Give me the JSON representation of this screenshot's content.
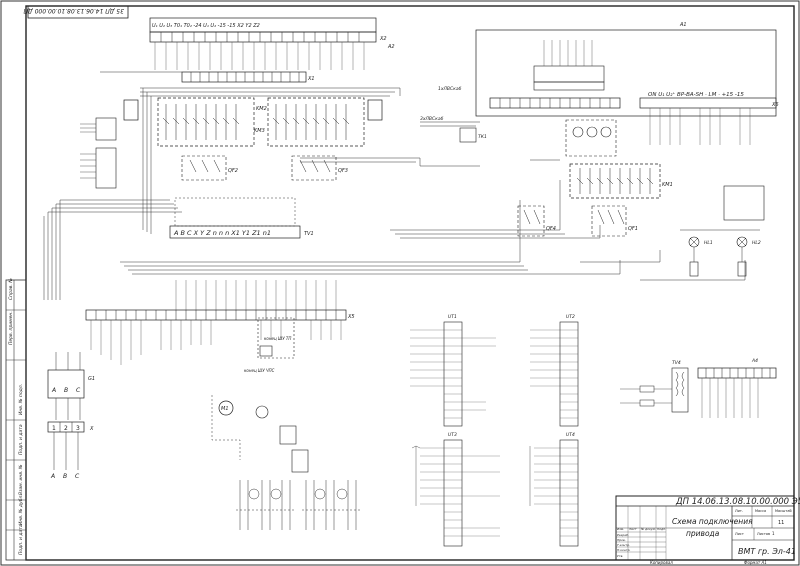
{
  "stamp": {
    "rotated_code": "35 ДП 14.06.13.08.10.00.000 ДП",
    "doc_code": "ДП 14.06.13.08.10.00.000 Э5",
    "title_line1": "Схема подключения",
    "title_line2": "привода",
    "org": "ВМТ гр. Эл-41",
    "sheet_label": "Лит.",
    "mass_label": "Масса",
    "scale_label": "Масштаб",
    "sheet_field": "Лист",
    "sheets_field": "Листов",
    "sheet_num": "11",
    "total_label": "1",
    "copied": "Копировал",
    "format": "Формат А1",
    "rows": [
      "Изм.",
      "Лист",
      "№ докум.",
      "Подп.",
      "Дата"
    ],
    "roles": [
      "Разраб.",
      "Пров.",
      "Т.контр.",
      "Н.контр.",
      "Утв."
    ]
  },
  "side_strip": [
    "Перв. примен.",
    "Справ. №",
    "Подп. и дата",
    "Инв. № дубл.",
    "Взам. инв. №",
    "Подп. и дата",
    "Инв. № подл."
  ],
  "modules": {
    "x1_label": "X1",
    "x2_label": "X2",
    "x3_label": "X3",
    "x4_label": "X4",
    "x5_label": "X5",
    "x6_label": "X6",
    "a1_label": "A1",
    "a2_label": "A2",
    "a4_label": "A4",
    "km1_label": "KM1",
    "km2_label": "KM2",
    "km3_label": "KM3",
    "qf1_label": "QF1",
    "qf2_label": "QF2",
    "qf3_label": "QF3",
    "qf4_label": "QF4",
    "tv1_label": "TV1",
    "tv2_label": "TV2",
    "tv4_label": "TV4",
    "hl1_label": "HL1",
    "hl2_label": "HL2",
    "m1_label": "M1",
    "g1_label": "G1",
    "x_label": "X",
    "ut1_label": "UT1",
    "ut2_label": "UT2",
    "ut3_label": "UT3",
    "ut4_label": "UT4",
    "x2_header": "U₁ U₂ U₃   T0₁ T0₂   -24   U₁ U₂   -15 -15  X2 Y2 Z2",
    "x6_header": "ON  U₁ U₂⁺    ВР-ВА-SH · LM · +15 -15",
    "abc_labels": [
      "A",
      "B",
      "C"
    ],
    "tv1_terms": "A B C  X Y Z n n n X1 Y1 Z1 n1",
    "encoder_note": "конец ШУ ТП",
    "encoder_note2": "конец ШУ ЧПС",
    "cable_top": "1xЛВСкаб",
    "cable_mid": "3xЛВСкаб",
    "tk_label": "ТК1"
  }
}
